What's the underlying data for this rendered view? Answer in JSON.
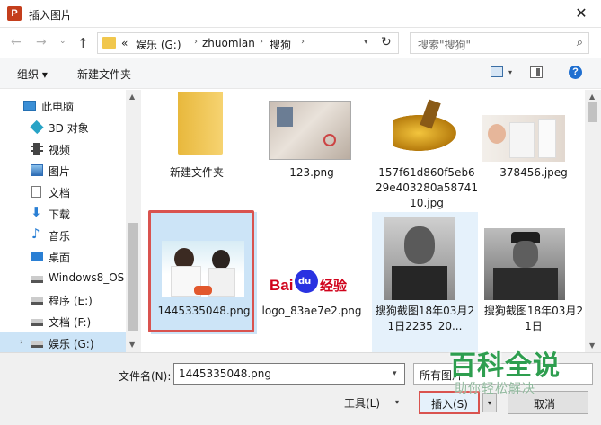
{
  "window": {
    "title": "插入图片",
    "close_glyph": "✕",
    "app_icon_letter": "P"
  },
  "nav": {
    "back_glyph": "←",
    "forward_glyph": "→",
    "up_glyph": "↑",
    "history_glyph": "⌄",
    "prefix": "«",
    "crumbs": [
      "娱乐 (G:)",
      "zhuomian",
      "搜狗"
    ],
    "sep": "›",
    "refresh_glyph": "↻"
  },
  "search": {
    "placeholder": "搜索\"搜狗\"",
    "icon": "search-icon"
  },
  "toolbar": {
    "organize": "组织 ▾",
    "new_folder": "新建文件夹",
    "help": "?"
  },
  "sidebar": {
    "items": [
      {
        "label": "此电脑",
        "icon": "computer-icon",
        "color": "#3b8fd6"
      },
      {
        "label": "3D 对象",
        "icon": "cube-icon",
        "color": "#27a3c6"
      },
      {
        "label": "视频",
        "icon": "film-icon",
        "color": "#444444"
      },
      {
        "label": "图片",
        "icon": "picture-icon",
        "color": "#2f6db5"
      },
      {
        "label": "文档",
        "icon": "document-icon",
        "color": "#7a7a7a"
      },
      {
        "label": "下载",
        "icon": "download-arrow-icon",
        "color": "#2a7fd4"
      },
      {
        "label": "音乐",
        "icon": "music-note-icon",
        "color": "#2a7fd4"
      },
      {
        "label": "桌面",
        "icon": "desktop-icon",
        "color": "#2a7fd4"
      },
      {
        "label": "Windows8_OS",
        "icon": "drive-icon",
        "color": "#555555"
      },
      {
        "label": "程序 (E:)",
        "icon": "drive-icon",
        "color": "#555555"
      },
      {
        "label": "文档 (F:)",
        "icon": "drive-icon",
        "color": "#555555"
      },
      {
        "label": "娱乐 (G:)",
        "icon": "drive-icon",
        "color": "#555555"
      }
    ]
  },
  "files": [
    {
      "name": "新建文件夹",
      "kind": "folder"
    },
    {
      "name": "123.png",
      "kind": "certificate"
    },
    {
      "name": "157f61d860f5eb629e403280a5874110.jpg",
      "kind": "gold"
    },
    {
      "name": "378456.jpeg",
      "kind": "doctor"
    },
    {
      "name": "1445335048.png",
      "kind": "nurse",
      "selected": true
    },
    {
      "name": "logo_83ae7e2.png",
      "kind": "baidu",
      "logo_text": "Bai",
      "logo_du": "du",
      "logo_cn": "经验"
    },
    {
      "name": "搜狗截图18年03月21日2235_20...",
      "kind": "portrait1",
      "highlighted": true
    },
    {
      "name": "搜狗截图18年03月21日",
      "kind": "portrait2"
    }
  ],
  "bottom": {
    "filename_label": "文件名(N):",
    "filename_value": "1445335048.png",
    "filetype_value": "所有图片",
    "tools": "工具(L)",
    "insert": "插入(S)",
    "cancel": "取消"
  },
  "watermark": {
    "big": "百科全说",
    "small": "助你轻松解决"
  },
  "colors": {
    "selection": "#cce4f7",
    "highlight": "#e5f1fb",
    "red_box": "#d9534f",
    "watermark": "#2e9e4f"
  }
}
